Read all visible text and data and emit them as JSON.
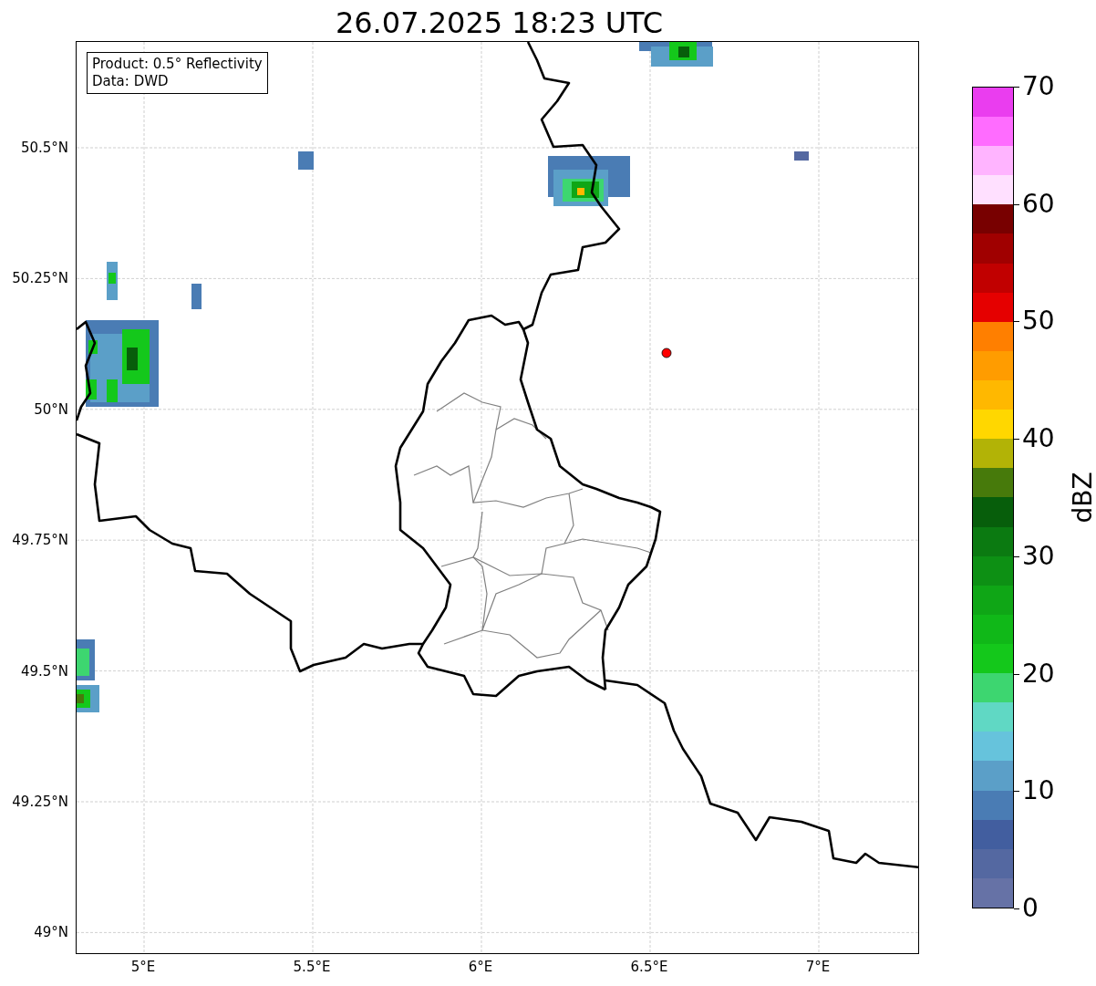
{
  "title": "26.07.2025 18:23 UTC",
  "legend": [
    "Product: 0.5° Reflectivity",
    "Data: DWD"
  ],
  "y_ticks": [
    "50.5°N",
    "50.25°N",
    "50°N",
    "49.75°N",
    "49.5°N",
    "49.25°N",
    "49°N"
  ],
  "x_ticks": [
    "5°E",
    "5.5°E",
    "6°E",
    "6.5°E",
    "7°E"
  ],
  "colorbar": {
    "label": "dBZ",
    "ticks": [
      "70",
      "60",
      "50",
      "40",
      "30",
      "20",
      "10",
      "0"
    ]
  }
}
